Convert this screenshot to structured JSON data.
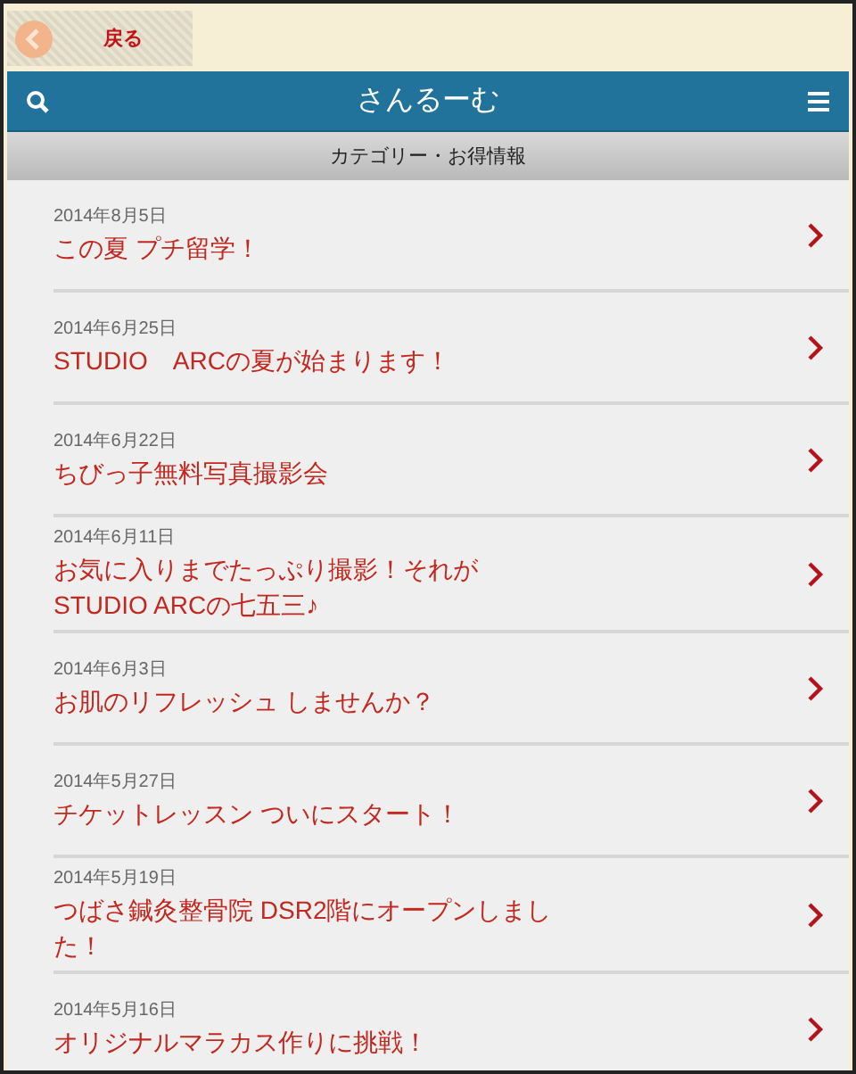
{
  "back_button": {
    "label": "戻る"
  },
  "header": {
    "title": "さんるーむ"
  },
  "category": {
    "title": "カテゴリー・お得情報"
  },
  "posts": [
    {
      "date": "2014年8月5日",
      "title": "この夏 プチ留学！"
    },
    {
      "date": "2014年6月25日",
      "title": "STUDIO　ARCの夏が始まります！"
    },
    {
      "date": "2014年6月22日",
      "title": "ちびっ子無料写真撮影会"
    },
    {
      "date": "2014年6月11日",
      "title": "お気に入りまでたっぷり撮影！それがSTUDIO ARCの七五三♪"
    },
    {
      "date": "2014年6月3日",
      "title": "お肌のリフレッシュ しませんか？"
    },
    {
      "date": "2014年5月27日",
      "title": "チケットレッスン ついにスタート！"
    },
    {
      "date": "2014年5月19日",
      "title": "つばさ鍼灸整骨院 DSR2階にオープンしました！"
    },
    {
      "date": "2014年5月16日",
      "title": "オリジナルマラカス作りに挑戦！"
    }
  ]
}
